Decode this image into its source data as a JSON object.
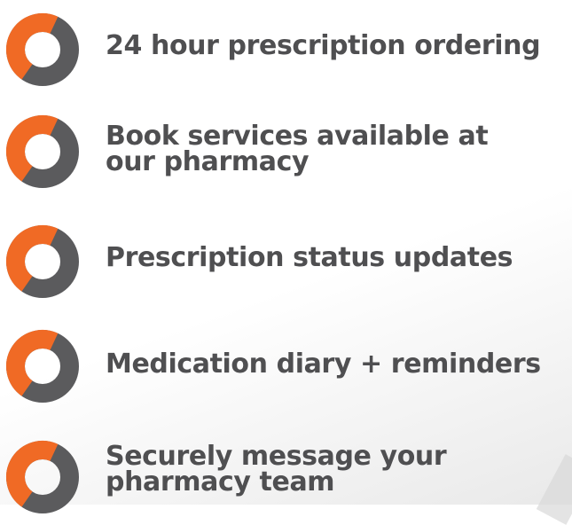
{
  "colors": {
    "ring_accent": "#f06a25",
    "ring_base": "#5b5b5d",
    "text": "#4f4f51"
  },
  "features": [
    {
      "icon": "ring-icon",
      "label": "24 hour prescription ordering"
    },
    {
      "icon": "ring-icon",
      "label": "Book services available at\nour pharmacy"
    },
    {
      "icon": "ring-icon",
      "label": "Prescription status updates"
    },
    {
      "icon": "ring-icon",
      "label": "Medication diary + reminders"
    },
    {
      "icon": "ring-icon",
      "label": "Securely message your\npharmacy team"
    }
  ]
}
